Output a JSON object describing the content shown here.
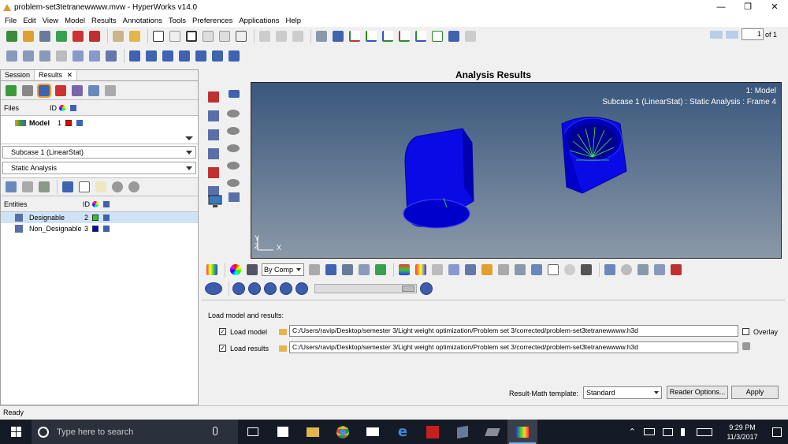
{
  "window": {
    "title": "problem-set3tetranewwww.mvw - HyperWorks v14.0",
    "minimize": "—",
    "restore": "❐",
    "close": "✕"
  },
  "menu": [
    "File",
    "Edit",
    "View",
    "Model",
    "Results",
    "Annotations",
    "Tools",
    "Preferences",
    "Applications",
    "Help"
  ],
  "page_nav": {
    "current": "1",
    "of_label": "of 1"
  },
  "left_panel": {
    "tabs": [
      {
        "label": "Session"
      },
      {
        "label": "Results"
      }
    ],
    "tab_close": "✕",
    "files_header": {
      "files": "Files",
      "id": "ID"
    },
    "model_row": {
      "label": "Model",
      "id": "1",
      "color": "#e00000"
    },
    "subcase_select": "Subcase 1 (LinearStat)",
    "analysis_select": "Static Analysis",
    "entities_header": {
      "entities": "Entities",
      "id": "ID"
    },
    "entities": [
      {
        "label": "Designable",
        "id": "2",
        "color": "#22cc22"
      },
      {
        "label": "Non_Designable",
        "id": "3",
        "color": "#0000ee"
      }
    ]
  },
  "viewport": {
    "title": "Analysis Results",
    "model_label": "1: Model",
    "subcase_label": "Subcase 1 (LinearStat) : Static Analysis : Frame 4",
    "axis_y": "Y",
    "axis_x": "X",
    "axis_z": "Z"
  },
  "result_toolbar": {
    "by_comp": "By Comp"
  },
  "load_panel": {
    "heading": "Load model and results:",
    "load_model_label": "Load model",
    "load_model_path": "C:/Users/ravip/Desktop/semester 3/Light weight optimization/Problem set 3/corrected/problem-set3tetranewwww.h3d",
    "load_results_label": "Load results",
    "load_results_path": "C:/Users/ravip/Desktop/semester 3/Light weight optimization/Problem set 3/corrected/problem-set3tetranewwww.h3d",
    "overlay_label": "Overlay",
    "template_label": "Result-Math template:",
    "template_value": "Standard",
    "reader_options": "Reader Options...",
    "apply": "Apply"
  },
  "status": "Ready",
  "taskbar": {
    "search_placeholder": "Type here to search",
    "time": "9:29 PM",
    "date": "11/3/2017"
  }
}
